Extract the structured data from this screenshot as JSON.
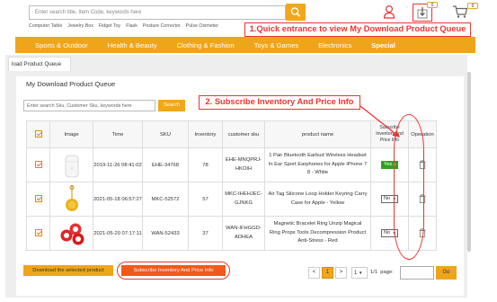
{
  "header": {
    "search_placeholder": "Enter search title, Item Code, keywords here",
    "hot_tags": [
      "Computer Table",
      "Jewelry Box",
      "Fidget Toy",
      "Flask",
      "Posture Corrector",
      "Pulse Oximeter"
    ],
    "download_badge": "0",
    "cart_badge": "0"
  },
  "callouts": {
    "download_entrance": "1.Quick entrance to view My Download Product Queue",
    "subscribe": "2. Subscribe Inventory And Price Info"
  },
  "categories": [
    {
      "label": "Sports & Outdoor"
    },
    {
      "label": "Health & Beauty"
    },
    {
      "label": "Clothing & Fashion"
    },
    {
      "label": "Toys & Games"
    },
    {
      "label": "Electronics"
    },
    {
      "label": "Special",
      "active": true
    }
  ],
  "tab_label": "load Product Queue",
  "page_title": "My Download Product Queue",
  "search": {
    "placeholder": "Enter search Sku, Customer Sku, keywords here",
    "button": "Search"
  },
  "table": {
    "columns": [
      "Image",
      "Time",
      "SKU",
      "Inventory",
      "customer sku",
      "product name",
      "Subscribe Inventory And Price Info",
      "Operation"
    ],
    "rows": [
      {
        "image": "airpods-case",
        "time": "2019-11-26 08:41:02",
        "sku": "EHE-34768",
        "inventory": "78",
        "customer_sku": "EHE-MNQPRJ-HKOIH",
        "product_name": "1 Pair Bluetooth Earbud Wireless Headset In Ear Sport Earphones for Apple iPhone 7 8 - White",
        "subscribe": "Yes"
      },
      {
        "image": "keyring",
        "time": "2021-05-18 06:57:27",
        "sku": "MKC-52572",
        "inventory": "57",
        "customer_sku": "MKC-IHEHJEC-GJNKG",
        "product_name": "Air Tag Silicone Loop Holder Keyring Carry Case for Apple - Yellow",
        "subscribe": "No"
      },
      {
        "image": "magnetic-ring",
        "time": "2021-05-20 07:17:11",
        "sku": "WAN-52433",
        "inventory": "37",
        "customer_sku": "WAN-IFHGGD-ADHEA",
        "product_name": "Magnetic Bracelet Ring Unzip Magical Ring Props Tools Decompression Product Anti-Stress - Red",
        "subscribe": "No"
      }
    ]
  },
  "footer": {
    "download_selected": "Download the selected product",
    "subscribe_button": "Subscribe Inventory And Price Info",
    "pagination": {
      "prev": "<",
      "current": "1",
      "next": ">",
      "page_select": "1",
      "total": "1/1",
      "page_label": "page:",
      "go": "Go"
    }
  },
  "colors": {
    "accent": "#efa51a",
    "callout": "#ee3333",
    "subscribe_btn": "#ef5a1a",
    "yes_green": "#2ea021"
  }
}
